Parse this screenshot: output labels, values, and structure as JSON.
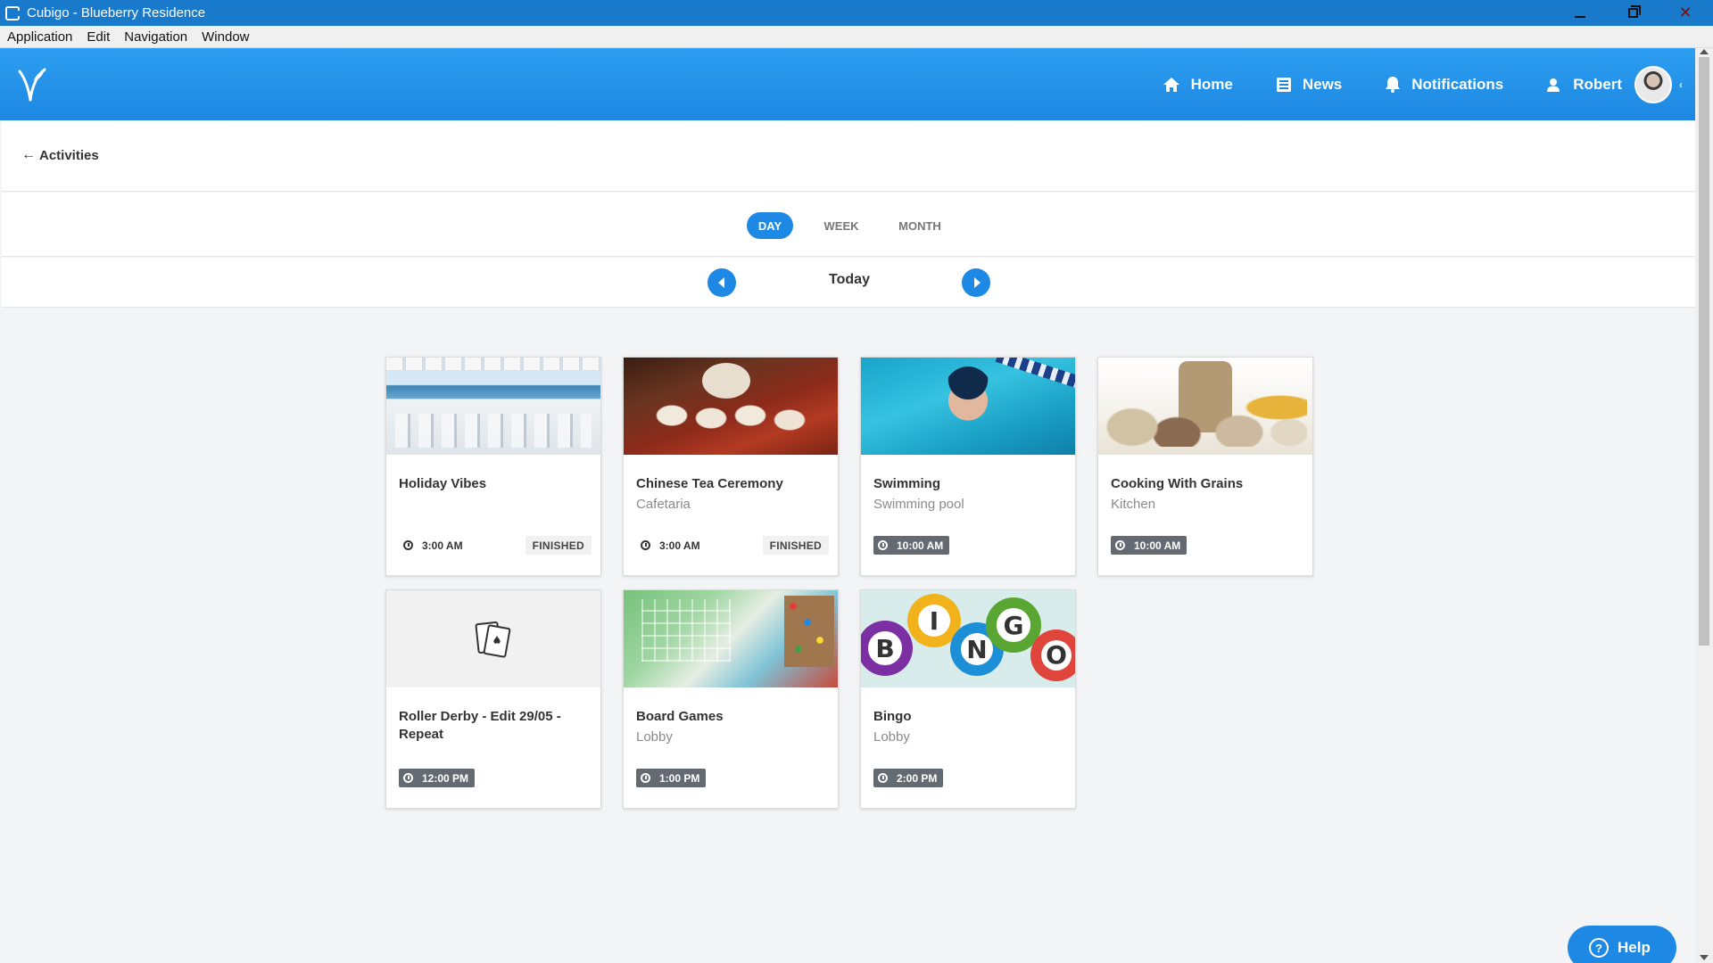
{
  "window": {
    "title": "Cubigo - Blueberry Residence"
  },
  "menu": [
    "Application",
    "Edit",
    "Navigation",
    "Window"
  ],
  "header": {
    "nav": {
      "home": "Home",
      "news": "News",
      "notifications": "Notifications"
    },
    "user": "Robert"
  },
  "breadcrumb": {
    "back_label": "Activities"
  },
  "view_toggle": {
    "day": "DAY",
    "week": "WEEK",
    "month": "MONTH",
    "selected": "DAY"
  },
  "date_nav": {
    "label": "Today"
  },
  "activities": [
    {
      "name": "Holiday Vibes",
      "location": "",
      "time": "3:00 AM",
      "status": "FINISHED"
    },
    {
      "name": "Chinese Tea Ceremony",
      "location": "Cafetaria",
      "time": "3:00 AM",
      "status": "FINISHED"
    },
    {
      "name": "Swimming",
      "location": "Swimming pool",
      "time": "10:00 AM",
      "status": ""
    },
    {
      "name": "Cooking With Grains",
      "location": "Kitchen",
      "time": "10:00 AM",
      "status": ""
    },
    {
      "name": "Roller Derby - Edit 29/05 - Repeat",
      "location": "",
      "time": "12:00 PM",
      "status": ""
    },
    {
      "name": "Board Games",
      "location": "Lobby",
      "time": "1:00 PM",
      "status": ""
    },
    {
      "name": "Bingo",
      "location": "Lobby",
      "time": "2:00 PM",
      "status": ""
    }
  ],
  "help_label": "Help",
  "colors": {
    "accent": "#1e88e5",
    "header": "#2c9ef0",
    "titlebar": "#1979ca",
    "time_badge": "#646a72"
  },
  "bingo_letters": [
    "B",
    "I",
    "N",
    "G",
    "O"
  ]
}
